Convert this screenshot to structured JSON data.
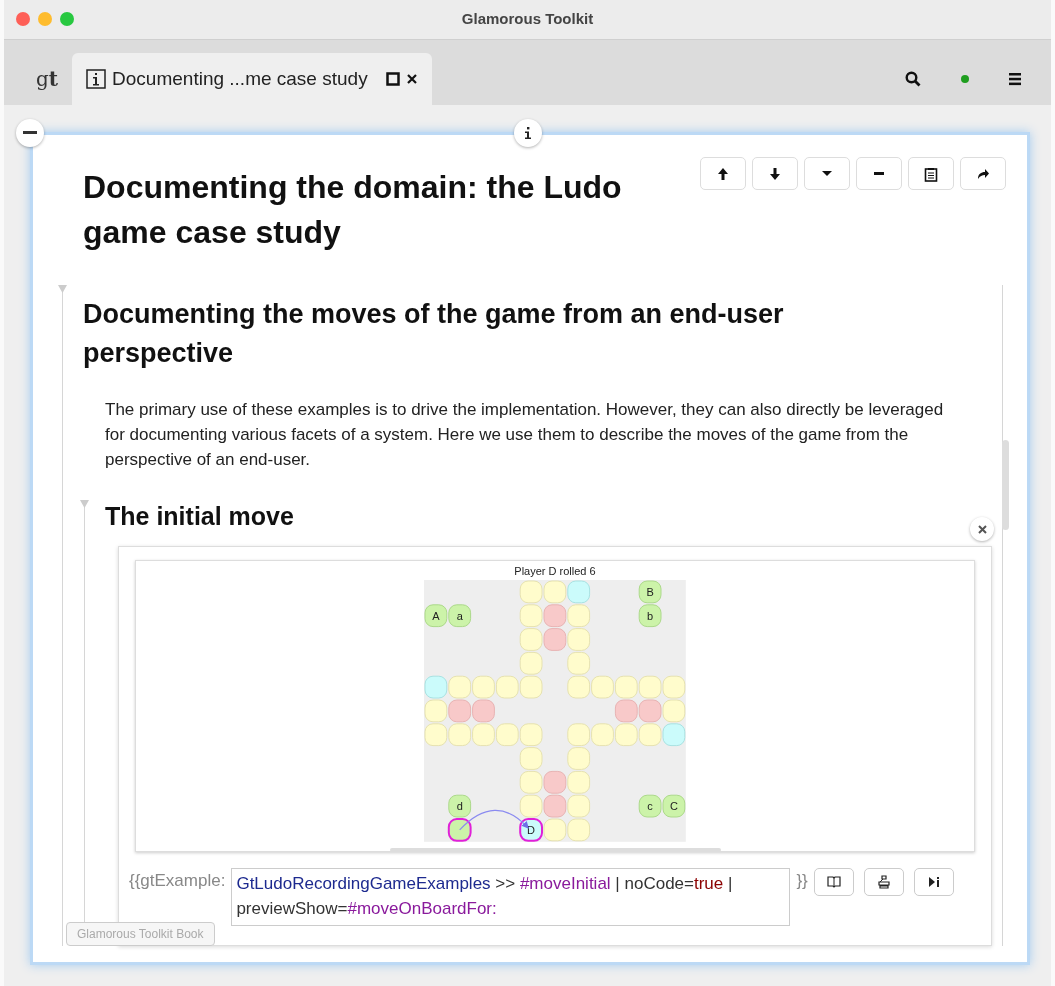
{
  "window": {
    "title": "Glamorous Toolkit"
  },
  "tabs": [
    {
      "kind": "logo",
      "label": "g**t**",
      "selected": false
    },
    {
      "kind": "page",
      "label": "Documenting ...me case study",
      "selected": true
    }
  ],
  "page": {
    "title": "Documenting the domain: the Ludo game case study",
    "section": {
      "title": "Documenting the moves of the game from an end-user perspective",
      "paragraph": "The primary use of these examples is to drive the implementation. However, they can also directly be leveraged for documenting various facets of a system. Here we use them to describe the moves of the game from the perspective of an end-user.",
      "subsection": {
        "title": "The initial move",
        "example": {
          "caption": "Player D rolled 6",
          "board": {
            "rows": [
              [
                null,
                null,
                null,
                null,
                {
                  "kind": "path"
                },
                {
                  "kind": "path"
                },
                {
                  "kind": "start"
                },
                null,
                null,
                {
                  "kind": "piece",
                  "label": "B"
                },
                null
              ],
              [
                {
                  "kind": "piece",
                  "label": "A"
                },
                {
                  "kind": "piece",
                  "label": "a"
                },
                null,
                null,
                {
                  "kind": "path"
                },
                {
                  "kind": "goal"
                },
                {
                  "kind": "path"
                },
                null,
                null,
                {
                  "kind": "piece",
                  "label": "b"
                },
                null
              ],
              [
                null,
                null,
                null,
                null,
                {
                  "kind": "path"
                },
                {
                  "kind": "goal"
                },
                {
                  "kind": "path"
                },
                null,
                null,
                null,
                null
              ],
              [
                null,
                null,
                null,
                null,
                {
                  "kind": "path"
                },
                null,
                {
                  "kind": "path"
                },
                null,
                null,
                null,
                null
              ],
              [
                {
                  "kind": "start"
                },
                {
                  "kind": "path"
                },
                {
                  "kind": "path"
                },
                {
                  "kind": "path"
                },
                {
                  "kind": "path"
                },
                null,
                {
                  "kind": "path"
                },
                {
                  "kind": "path"
                },
                {
                  "kind": "path"
                },
                {
                  "kind": "path"
                },
                {
                  "kind": "path"
                }
              ],
              [
                {
                  "kind": "path"
                },
                {
                  "kind": "goal"
                },
                {
                  "kind": "goal"
                },
                null,
                null,
                null,
                null,
                null,
                {
                  "kind": "goal"
                },
                {
                  "kind": "goal"
                },
                {
                  "kind": "path"
                }
              ],
              [
                {
                  "kind": "path"
                },
                {
                  "kind": "path"
                },
                {
                  "kind": "path"
                },
                {
                  "kind": "path"
                },
                {
                  "kind": "path"
                },
                null,
                {
                  "kind": "path"
                },
                {
                  "kind": "path"
                },
                {
                  "kind": "path"
                },
                {
                  "kind": "path"
                },
                {
                  "kind": "start"
                }
              ],
              [
                null,
                null,
                null,
                null,
                {
                  "kind": "path"
                },
                null,
                {
                  "kind": "path"
                },
                null,
                null,
                null,
                null
              ],
              [
                null,
                null,
                null,
                null,
                {
                  "kind": "path"
                },
                {
                  "kind": "goal"
                },
                {
                  "kind": "path"
                },
                null,
                null,
                null,
                null
              ],
              [
                null,
                {
                  "kind": "piece",
                  "label": "d"
                },
                null,
                null,
                {
                  "kind": "path"
                },
                {
                  "kind": "goal"
                },
                {
                  "kind": "path"
                },
                null,
                null,
                {
                  "kind": "piece",
                  "label": "c"
                },
                {
                  "kind": "piece",
                  "label": "C"
                }
              ],
              [
                null,
                {
                  "kind": "piece",
                  "highlighted": true
                },
                null,
                null,
                {
                  "kind": "start",
                  "label": "D",
                  "highlighted": true
                },
                {
                  "kind": "path"
                },
                {
                  "kind": "path"
                },
                null,
                null,
                null,
                null
              ]
            ]
          },
          "prefix": "{{gtExample:",
          "code": [
            {
              "kind": "class",
              "text": "GtLudoRecordingGameExamples"
            },
            {
              "kind": "plain",
              "text": " >> "
            },
            {
              "kind": "symbol",
              "text": "#moveInitial"
            },
            {
              "kind": "plain",
              "text": " | noCode="
            },
            {
              "kind": "literal",
              "text": "true"
            },
            {
              "kind": "plain",
              "text": " | previewShow="
            },
            {
              "kind": "symbol",
              "text": "#moveOnBoardFor:"
            }
          ],
          "suffix": "}}"
        }
      }
    }
  },
  "footer_button": {
    "label": "Glamorous Toolkit Book",
    "disabled": true
  }
}
